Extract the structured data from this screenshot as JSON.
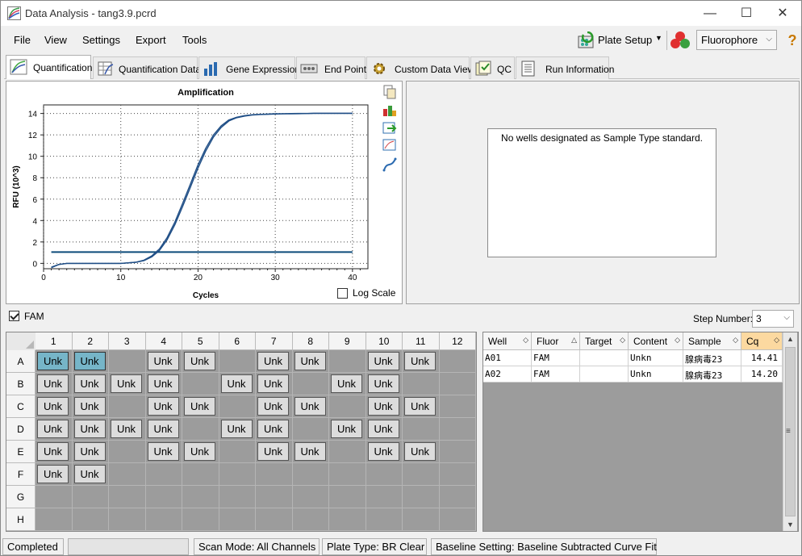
{
  "window": {
    "title": "Data Analysis - tang3.9.pcrd",
    "minimize": "—",
    "maximize": "☐",
    "close": "✕"
  },
  "menu": [
    "File",
    "View",
    "Settings",
    "Export",
    "Tools"
  ],
  "toolbar": {
    "plate_setup": "Plate Setup",
    "fluorophore": "Fluorophore",
    "help": "?"
  },
  "tabs": [
    "Quantification",
    "Quantification Data",
    "Gene Expression",
    "End Point",
    "Custom Data View",
    "QC",
    "Run Information"
  ],
  "chart_data": {
    "type": "line",
    "title": "Amplification",
    "xlabel": "Cycles",
    "ylabel": "RFU (10^3)",
    "xlim": [
      0,
      42
    ],
    "ylim": [
      -0.5,
      14.8
    ],
    "xticks": [
      0,
      10,
      20,
      30,
      40
    ],
    "yticks": [
      0,
      2,
      4,
      6,
      8,
      10,
      12,
      14
    ],
    "grid": true,
    "threshold": 1.05,
    "series": [
      {
        "x": [
          1,
          2,
          3,
          4,
          5,
          6,
          7,
          8,
          9,
          10,
          11,
          12,
          13,
          14,
          15,
          16,
          17,
          18,
          19,
          20,
          21,
          22,
          23,
          24,
          25,
          26,
          27,
          28,
          29,
          30,
          31,
          32,
          33,
          34,
          35,
          36,
          37,
          38,
          39,
          40
        ],
        "values": [
          -0.4,
          -0.1,
          0.0,
          0.0,
          0.0,
          0.0,
          0.0,
          0.0,
          0.0,
          0.0,
          0.05,
          0.1,
          0.25,
          0.6,
          1.2,
          2.2,
          3.6,
          5.3,
          7.1,
          8.9,
          10.5,
          11.8,
          12.7,
          13.3,
          13.6,
          13.75,
          13.85,
          13.9,
          13.92,
          13.95,
          13.96,
          13.97,
          13.98,
          13.99,
          14.0,
          14.0,
          14.0,
          14.0,
          14.0,
          14.0
        ]
      },
      {
        "x": [
          1,
          2,
          3,
          4,
          5,
          6,
          7,
          8,
          9,
          10,
          11,
          12,
          13,
          14,
          15,
          16,
          17,
          18,
          19,
          20,
          21,
          22,
          23,
          24,
          25,
          26,
          27,
          28,
          29,
          30,
          31,
          32,
          33,
          34,
          35,
          36,
          37,
          38,
          39,
          40
        ],
        "values": [
          -0.35,
          -0.1,
          0.0,
          0.0,
          0.0,
          0.0,
          0.0,
          0.0,
          0.0,
          0.0,
          0.05,
          0.12,
          0.3,
          0.7,
          1.35,
          2.4,
          3.85,
          5.6,
          7.4,
          9.2,
          10.75,
          12.0,
          12.85,
          13.4,
          13.65,
          13.8,
          13.88,
          13.92,
          13.95,
          13.97,
          13.98,
          13.99,
          14.0,
          14.0,
          14.02,
          14.02,
          14.02,
          14.02,
          14.02,
          14.02
        ]
      }
    ],
    "log_scale_label": "Log Scale"
  },
  "standard_message": "No wells designated as Sample Type standard.",
  "fam_label": "FAM",
  "step": {
    "label": "Step Number:",
    "value": "3"
  },
  "plate": {
    "cols": [
      "1",
      "2",
      "3",
      "4",
      "5",
      "6",
      "7",
      "8",
      "9",
      "10",
      "11",
      "12"
    ],
    "rows": [
      "A",
      "B",
      "C",
      "D",
      "E",
      "F",
      "G",
      "H"
    ],
    "well_label": "Unk",
    "occupied": {
      "A": [
        1,
        2,
        4,
        5,
        7,
        8,
        10,
        11
      ],
      "B": [
        1,
        2,
        3,
        4,
        6,
        7,
        9,
        10
      ],
      "C": [
        1,
        2,
        4,
        5,
        7,
        8,
        10,
        11
      ],
      "D": [
        1,
        2,
        3,
        4,
        6,
        7,
        9,
        10
      ],
      "E": [
        1,
        2,
        4,
        5,
        7,
        8,
        10,
        11
      ],
      "F": [
        1,
        2
      ],
      "G": [],
      "H": []
    },
    "selected": [
      "A1",
      "A2"
    ]
  },
  "table": {
    "headers": [
      "Well",
      "Fluor",
      "Target",
      "Content",
      "Sample",
      "Cq"
    ],
    "rows": [
      [
        "A01",
        "FAM",
        "",
        "Unkn",
        "腺病毒23",
        "14.41"
      ],
      [
        "A02",
        "FAM",
        "",
        "Unkn",
        "腺病毒23",
        "14.20"
      ]
    ]
  },
  "status": {
    "state": "Completed",
    "scan_mode": "Scan Mode: All Channels",
    "plate_type": "Plate Type: BR Clear",
    "baseline": "Baseline Setting: Baseline Subtracted Curve Fit"
  },
  "colors": {
    "curve": "#1f4e86",
    "threshold": "#0d4b7a",
    "selected_well": "#76b5c8",
    "cq_header": "#fcd9a0"
  }
}
